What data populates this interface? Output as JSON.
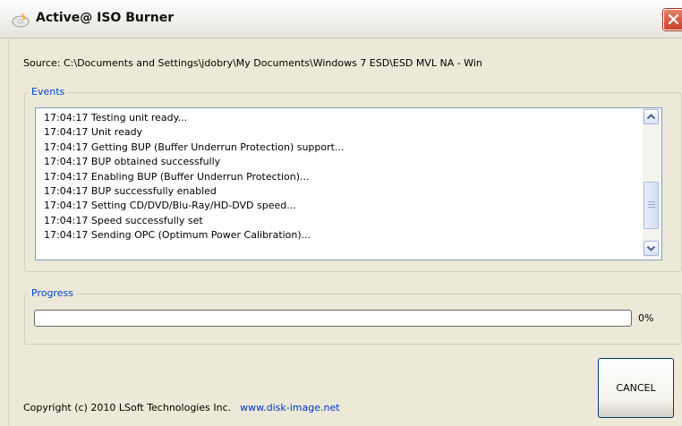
{
  "window": {
    "title": "Active@ ISO Burner"
  },
  "source": {
    "text": "Source: C:\\Documents and Settings\\jdobry\\My Documents\\Windows 7 ESD\\ESD MVL NA - Win"
  },
  "events": {
    "label": "Events",
    "lines": [
      "17:04:17 Testing unit ready...",
      "17:04:17 Unit ready",
      "17:04:17 Getting BUP (Buffer Underrun Protection) support...",
      "17:04:17 BUP obtained successfully",
      "17:04:17 Enabling BUP (Buffer Underrun Protection)...",
      "17:04:17 BUP successfully enabled",
      "17:04:17 Setting CD/DVD/Blu-Ray/HD-DVD speed...",
      "17:04:17 Speed successfully set",
      "17:04:17 Sending OPC (Optimum Power Calibration)..."
    ]
  },
  "progress": {
    "label": "Progress",
    "value": 0,
    "percent_text": "0%"
  },
  "buttons": {
    "cancel": "CANCEL"
  },
  "footer": {
    "copyright": "Copyright (c) 2010 LSoft Technologies Inc.",
    "link": "www.disk-image.net"
  },
  "icons": {
    "app": "disc-burner-icon",
    "close": "close-icon",
    "scroll_up": "chevron-up-icon",
    "scroll_down": "chevron-down-icon"
  },
  "colors": {
    "accent": "#0046d5",
    "link": "#0033cc",
    "progress_fill": "#2dbb3f",
    "close": "#c9422a"
  }
}
